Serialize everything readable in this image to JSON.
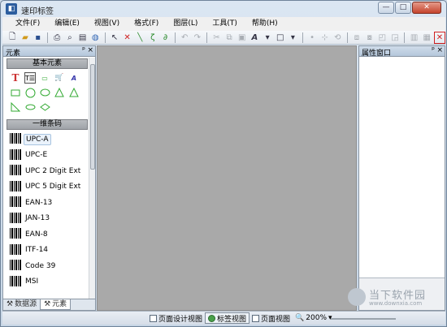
{
  "window": {
    "title": "速印标签",
    "minimize": "—",
    "maximize": "□",
    "close": "✕"
  },
  "menu": [
    "文件(F)",
    "编辑(E)",
    "视图(V)",
    "格式(F)",
    "图层(L)",
    "工具(T)",
    "帮助(H)"
  ],
  "left_panel": {
    "title": "元素",
    "pin": "ᵖ",
    "close": "×",
    "basic_group": "基本元素",
    "barcode_group": "一维条码",
    "barcodes": [
      "UPC-A",
      "UPC-E",
      "UPC 2 Digit Ext",
      "UPC 5 Digit Ext",
      "EAN-13",
      "JAN-13",
      "EAN-8",
      "ITF-14",
      "Code 39",
      "MSI"
    ],
    "tabs": [
      "数据源",
      "元素"
    ]
  },
  "right_panel": {
    "title": "属性窗口",
    "pin": "ᵖ",
    "close": "×"
  },
  "statusbar": {
    "design_view": "页面设计视图",
    "label_view": "标签视图",
    "page_view": "页面视图",
    "zoom": "200%"
  },
  "watermark": {
    "title": "当下软件园",
    "url": "www.downxia.com"
  }
}
